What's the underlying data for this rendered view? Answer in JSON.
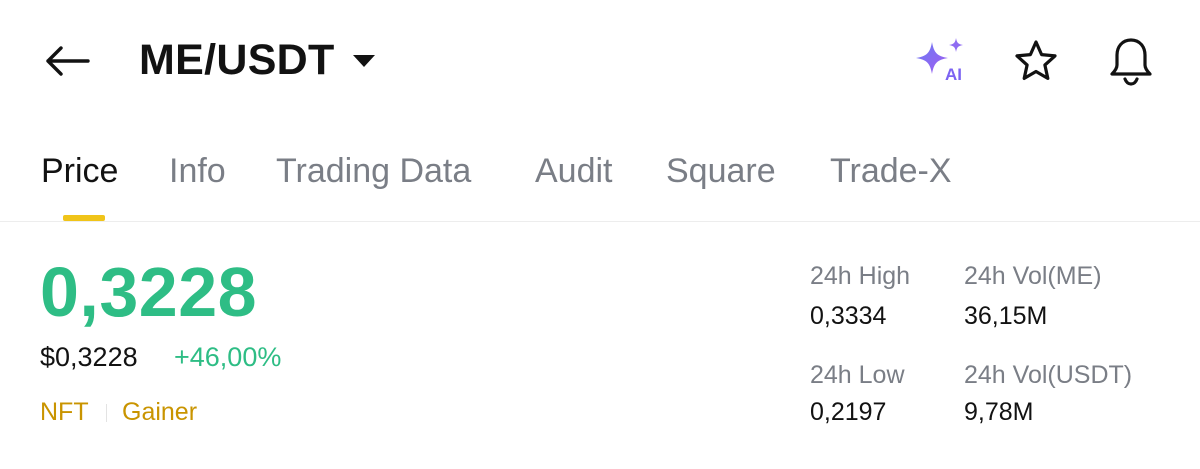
{
  "header": {
    "pair": "ME/USDT",
    "ai_badge": "AI",
    "icons": [
      "arrow-left-icon",
      "caret-down-icon",
      "ai-sparkle-icon",
      "star-icon",
      "bell-icon"
    ]
  },
  "tabs": [
    {
      "label": "Price",
      "active": true
    },
    {
      "label": "Info",
      "active": false
    },
    {
      "label": "Trading Data",
      "active": false
    },
    {
      "label": "Audit",
      "active": false
    },
    {
      "label": "Square",
      "active": false
    },
    {
      "label": "Trade-X",
      "active": false
    }
  ],
  "price": {
    "last": "0,3228",
    "usd": "$0,3228",
    "change": "+46,00%"
  },
  "tags": [
    "NFT",
    "Gainer"
  ],
  "stats": {
    "high_label": "24h High",
    "high_value": "0,3334",
    "low_label": "24h Low",
    "low_value": "0,2197",
    "vol_base_label": "24h Vol(ME)",
    "vol_base_value": "36,15M",
    "vol_quote_label": "24h Vol(USDT)",
    "vol_quote_value": "9,78M"
  },
  "colors": {
    "up": "#2ebd85",
    "tag": "#c99400",
    "indicator": "#f0c419",
    "muted": "#7a7e86"
  }
}
